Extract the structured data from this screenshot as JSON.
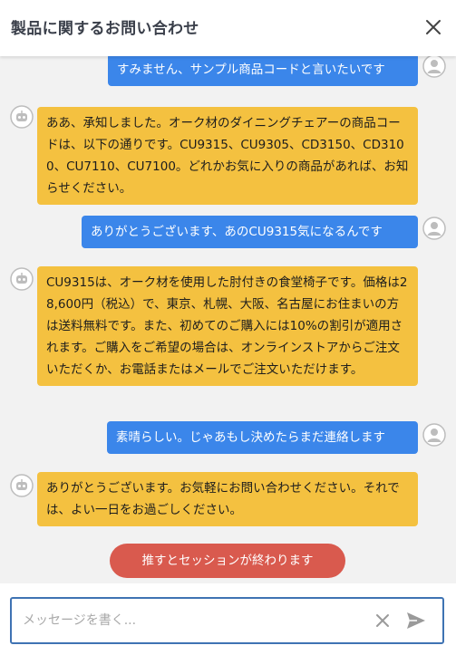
{
  "header": {
    "title": "製品に関するお問い合わせ",
    "close_icon": "close-icon"
  },
  "messages": [
    {
      "sender": "user",
      "text": "すみません、サンプル商品コードと言いたいです"
    },
    {
      "sender": "bot",
      "text": "ああ、承知しました。オーク材のダイニングチェアーの商品コードは、以下の通りです。CU9315、CU9305、CD3150、CD3100、CU7110、CU7100。どれかお気に入りの商品があれば、お知らせください。"
    },
    {
      "sender": "user",
      "text": "ありがとうございます、あのCU9315気になるんです"
    },
    {
      "sender": "bot",
      "text": "CU9315は、オーク材を使用した肘付きの食堂椅子です。価格は28,600円（税込）で、東京、札幌、大阪、名古屋にお住まいの方は送料無料です。また、初めてのご購入には10%の割引が適用されます。ご購入をご希望の場合は、オンラインストアからご注文いただくか、お電話またはメールでご注文いただけます。"
    },
    {
      "sender": "user",
      "text": "素晴らしい。じゃあもし決めたらまだ連絡します"
    },
    {
      "sender": "bot",
      "text": "ありがとうございます。お気軽にお問い合わせください。それでは、よい一日をお過ごしください。"
    }
  ],
  "end_session": {
    "label": "推すとセッションが終わります"
  },
  "composer": {
    "placeholder": "メッセージを書く...",
    "value": "",
    "clear_icon": "clear-icon",
    "send_icon": "send-icon"
  },
  "colors": {
    "user_bubble": "#3b86ea",
    "bot_bubble": "#f4c140",
    "end_button": "#d95a4e",
    "input_border": "#3f73b3",
    "background": "#f2f2f2"
  }
}
